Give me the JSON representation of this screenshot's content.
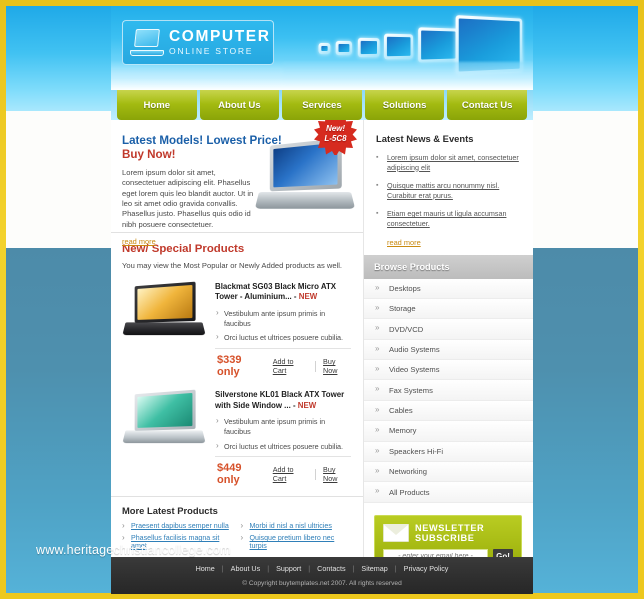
{
  "logo": {
    "line1": "COMPUTER",
    "line2": "ONLINE STORE",
    "icon": "laptop-icon"
  },
  "nav": {
    "items": [
      "Home",
      "About Us",
      "Services",
      "Solutions",
      "Contact Us"
    ]
  },
  "banner": {
    "heading_line1": "Latest Models! Lowest Price!",
    "heading_line2": "Buy Now!",
    "body": "Lorem ipsum dolor sit amet, consectetuer adipiscing elit. Phasellus eget lorem quis leo blandit auctor. Ut in leo sit amet odio gravida convallis. Phasellus justo. Phasellus quis odio id nibh posuere consectetuer.",
    "read_more": "read more",
    "badge_line1": "New!",
    "badge_line2": "L-5C8"
  },
  "news": {
    "title": "Latest News & Events",
    "items": [
      "Lorem ipsum dolor sit amet, consectetuer adipiscing elit",
      "Quisque mattis arcu nonummy nisl. Curabitur erat purus.",
      "Etiam eget mauris ut ligula accumsan consectetuer."
    ],
    "read_more": "read more"
  },
  "specials": {
    "title": "New/ Special Products",
    "subtitle": "You may view the Most Popular or Newly Added products as well.",
    "products": [
      {
        "name": "Blackmat SG03 Black Micro ATX Tower - Aluminium... -",
        "tag": "NEW",
        "features": [
          "Vestibulum ante ipsum primis in faucibus",
          "Orci luctus et ultrices posuere cubilia."
        ],
        "price": "$339 only",
        "add_to_cart": "Add to Cart",
        "buy_now": "Buy Now",
        "image": "black-laptop-amber-screen"
      },
      {
        "name": "Silverstone KL01 Black ATX Tower with Side Window ... -",
        "tag": "NEW",
        "features": [
          "Vestibulum ante ipsum primis in faucibus",
          "Orci luctus et ultrices posuere cubilia."
        ],
        "price": "$449 only",
        "add_to_cart": "Add to Cart",
        "buy_now": "Buy Now",
        "image": "silver-laptop-teal-screen"
      }
    ]
  },
  "more_products": {
    "title": "More Latest Products",
    "links": [
      "Praesent dapibus semper nulla",
      "Morbi id nisl a nisl ultricies",
      "Phasellus facilisis magna sit amet",
      "Quisque pretium libero nec turpis"
    ]
  },
  "browse": {
    "title": "Browse Products",
    "items": [
      "Desktops",
      "Storage",
      "DVD/VCD",
      "Audio Systems",
      "Video Systems",
      "Fax Systems",
      "Cables",
      "Memory",
      "Speackers Hi-Fi",
      "Networking",
      "All Products"
    ]
  },
  "newsletter": {
    "title": "NEWSLETTER  SUBSCRIBE",
    "placeholder": "- enter your email here -",
    "value": "",
    "button": "Go!",
    "icon": "envelope-icon"
  },
  "footer": {
    "links": [
      "Home",
      "About Us",
      "Support",
      "Contacts",
      "Sitemap",
      "Privacy Policy"
    ],
    "separator": "|",
    "copyright": "© Copyright buytemplates.net 2007. All rights reserved"
  },
  "watermark": "www.heritagechristiancollege.com",
  "colors": {
    "nav_green": "#a4bb11",
    "sky_blue": "#3cc0f2",
    "steel_blue": "#4e90ae",
    "gold_frame": "#edc81e",
    "price_red": "#d6512a",
    "heading_blue": "#1a5fa8",
    "heading_red": "#c0392b"
  }
}
